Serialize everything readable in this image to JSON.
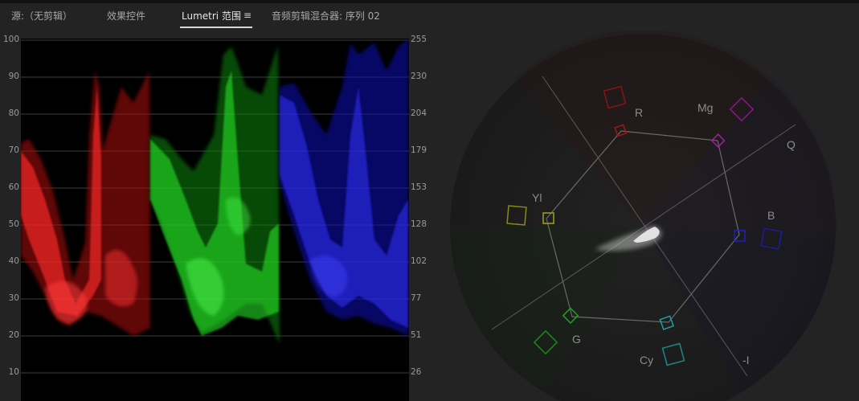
{
  "tabs": [
    {
      "label": "源:（无剪辑）"
    },
    {
      "label": "效果控件"
    },
    {
      "label": "Lumetri 范围"
    },
    {
      "label": "音频剪辑混合器: 序列 02"
    }
  ],
  "active_tab_index": 2,
  "menu_icon": "hamburger-menu-icon",
  "waveform": {
    "mode": "RGB parade",
    "left_scale": [
      "100",
      "90",
      "80",
      "70",
      "60",
      "50",
      "40",
      "30",
      "20",
      "10"
    ],
    "right_scale": [
      "255",
      "230",
      "204",
      "179",
      "153",
      "128",
      "102",
      "77",
      "51",
      "26"
    ],
    "channels": [
      {
        "name": "R",
        "color": "#e01818"
      },
      {
        "name": "G",
        "color": "#22d822"
      },
      {
        "name": "B",
        "color": "#2020e0"
      }
    ]
  },
  "vectorscope": {
    "targets": [
      {
        "label": "R",
        "color": "#b01818"
      },
      {
        "label": "Mg",
        "color": "#a020a0"
      },
      {
        "label": "B",
        "color": "#2020b0"
      },
      {
        "label": "Cy",
        "color": "#20a0a0"
      },
      {
        "label": "G",
        "color": "#20a020"
      },
      {
        "label": "Yl",
        "color": "#a0a020"
      }
    ],
    "axis_labels": [
      "Q",
      "-I"
    ],
    "label_color": "#8c8c8c"
  }
}
